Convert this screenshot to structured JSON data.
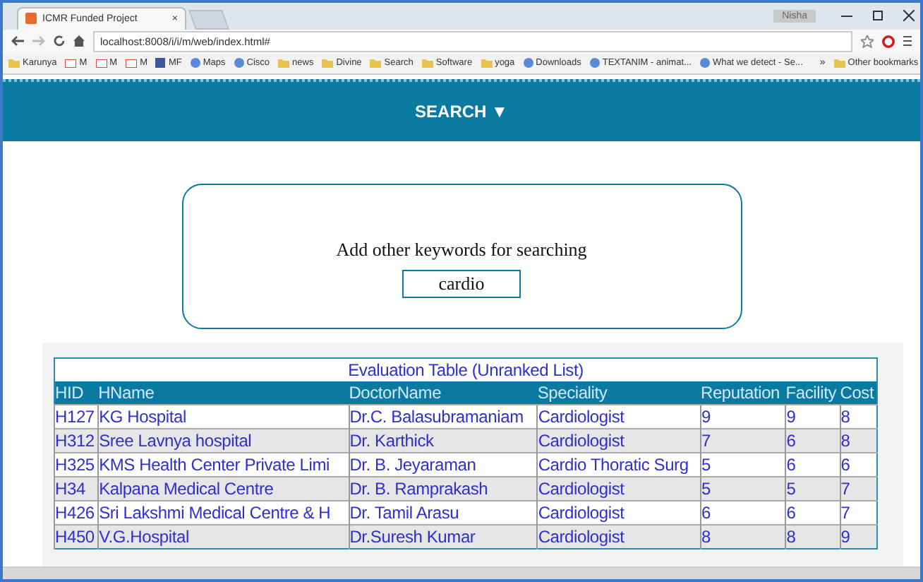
{
  "browser": {
    "tab_title": "ICMR Funded Project",
    "tab_close": "×",
    "user_label": "Nisha",
    "address": "localhost:8008/i/i/m/web/index.html#",
    "bookmarks": [
      {
        "label": "Karunya",
        "kind": "folder"
      },
      {
        "label": "M",
        "kind": "mail"
      },
      {
        "label": "M",
        "kind": "mail"
      },
      {
        "label": "M",
        "kind": "mail"
      },
      {
        "label": "MF",
        "kind": "social"
      },
      {
        "label": "Maps",
        "kind": "site"
      },
      {
        "label": "Cisco",
        "kind": "site"
      },
      {
        "label": "news",
        "kind": "folder"
      },
      {
        "label": "Divine",
        "kind": "folder"
      },
      {
        "label": "Search",
        "kind": "folder"
      },
      {
        "label": "Software",
        "kind": "folder"
      },
      {
        "label": "yoga",
        "kind": "folder"
      },
      {
        "label": "Downloads",
        "kind": "site"
      },
      {
        "label": "TEXTANIM - animat...",
        "kind": "site"
      },
      {
        "label": "What we detect - Se...",
        "kind": "site"
      }
    ],
    "overflow": "»",
    "other_bookmarks": "Other bookmarks"
  },
  "header": {
    "menu": "SEARCH ▼"
  },
  "search": {
    "prompt": "Add other keywords for searching",
    "value": "cardio"
  },
  "table": {
    "title": "Evaluation Table (Unranked List)",
    "columns": [
      "HID",
      "HName",
      "DoctorName",
      "Speciality",
      "Reputation",
      "Facility",
      "Cost"
    ],
    "rows": [
      [
        "H127",
        "KG Hospital",
        "Dr.C. Balasubramaniam",
        "Cardiologist",
        "9",
        "9",
        "8"
      ],
      [
        "H312",
        "Sree Lavnya hospital",
        "Dr. Karthick",
        "Cardiologist",
        "7",
        "6",
        "8"
      ],
      [
        "H325",
        "KMS Health Center Private Limi",
        "Dr. B. Jeyaraman",
        "Cardio Thoratic Surg",
        "5",
        "6",
        "6"
      ],
      [
        "H34",
        "Kalpana Medical Centre",
        "Dr. B. Ramprakash",
        "Cardiologist",
        "5",
        "5",
        "7"
      ],
      [
        "H426",
        "Sri Lakshmi Medical Centre & H",
        "Dr. Tamil Arasu",
        "Cardiologist",
        "6",
        "6",
        "7"
      ],
      [
        "H450",
        "V.G.Hospital",
        "Dr.Suresh Kumar",
        "Cardiologist",
        "8",
        "8",
        "9"
      ]
    ]
  }
}
